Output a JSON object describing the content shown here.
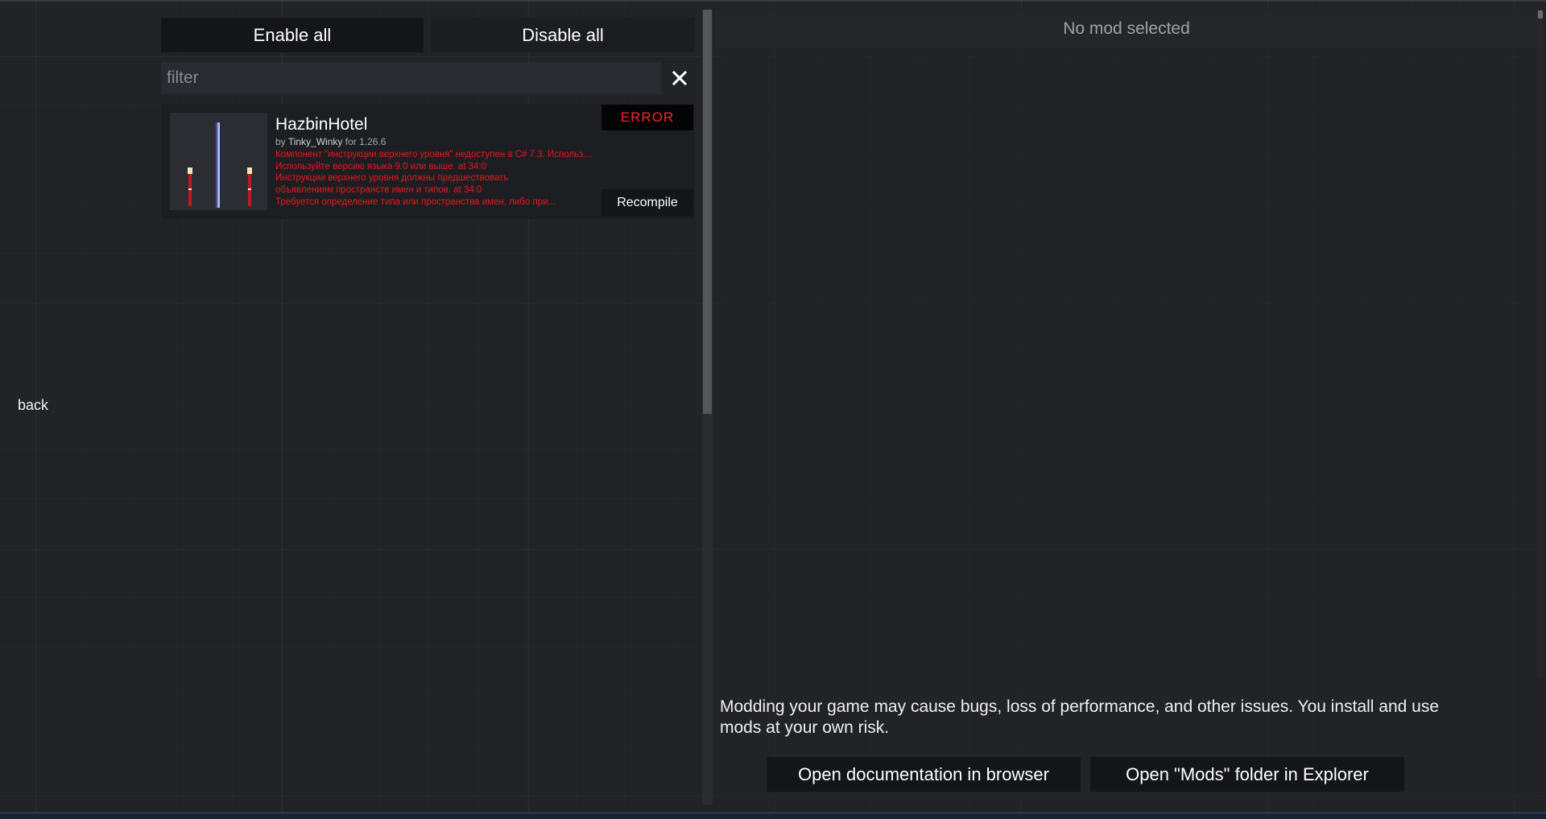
{
  "nav": {
    "back_label": "back"
  },
  "toolbar": {
    "enable_all_label": "Enable all",
    "disable_all_label": "Disable all"
  },
  "filter": {
    "placeholder": "filter",
    "value": "",
    "clear_icon": "close-icon"
  },
  "mods": [
    {
      "title": "HazbinHotel",
      "by_label": "by",
      "author": "Tinky_Winky",
      "for_label": "for",
      "version": "1.26.6",
      "status_badge": "ERROR",
      "recompile_label": "Recompile",
      "errors": [
        "Компонент \"инструкции верхнего уровня\" недоступен в C# 7.3. Используйте версию языка 9.0 или выше. at 34:0",
        "Используйте версию языка 9.0 или выше. at 34:0",
        "Инструкции верхнего уровня должны предшествовать",
        "объявлениям пространств имен и типов. at 34:0",
        "Требуется определение типа или пространства имен, либо при..."
      ]
    }
  ],
  "detail": {
    "empty_label": "No mod selected",
    "disclaimer": "Modding your game may cause bugs, loss of performance, and other issues. You install and use mods at your own risk.",
    "open_docs_label": "Open documentation in browser",
    "open_folder_label": "Open \"Mods\" folder in Explorer"
  },
  "colors": {
    "background": "#222327",
    "error_red": "#e8161e",
    "badge_red": "#ff1f2a",
    "button_bg": "#141518"
  }
}
